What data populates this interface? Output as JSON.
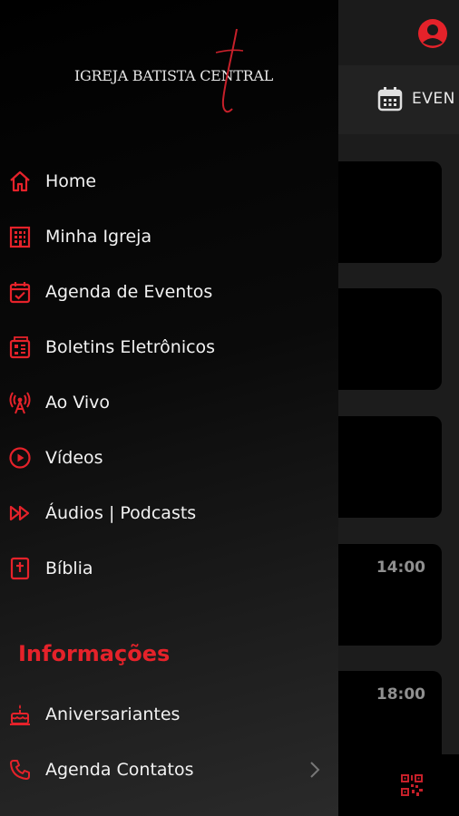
{
  "brand": {
    "name": "IGREJA BATISTA CENTRAL",
    "accent": "#e5222a"
  },
  "topbar": {
    "tab_events": "EVEN"
  },
  "cards": [
    {
      "time": ""
    },
    {
      "time": ""
    },
    {
      "time": ""
    },
    {
      "time": "14:00"
    },
    {
      "time": "18:00"
    }
  ],
  "menu": {
    "items": [
      {
        "label": "Home",
        "icon": "home-icon"
      },
      {
        "label": "Minha Igreja",
        "icon": "building-icon"
      },
      {
        "label": "Agenda de Eventos",
        "icon": "calendar-check-icon"
      },
      {
        "label": "Boletins Eletrônicos",
        "icon": "bulletin-icon"
      },
      {
        "label": "Ao Vivo",
        "icon": "broadcast-icon"
      },
      {
        "label": "Vídeos",
        "icon": "play-circle-icon"
      },
      {
        "label": "Áudios | Podcasts",
        "icon": "fast-forward-icon"
      },
      {
        "label": "Bíblia",
        "icon": "bible-icon"
      }
    ],
    "section_title": "Informações",
    "info_items": [
      {
        "label": "Aniversariantes",
        "icon": "cake-icon"
      },
      {
        "label": "Agenda Contatos",
        "icon": "phone-icon"
      }
    ]
  }
}
